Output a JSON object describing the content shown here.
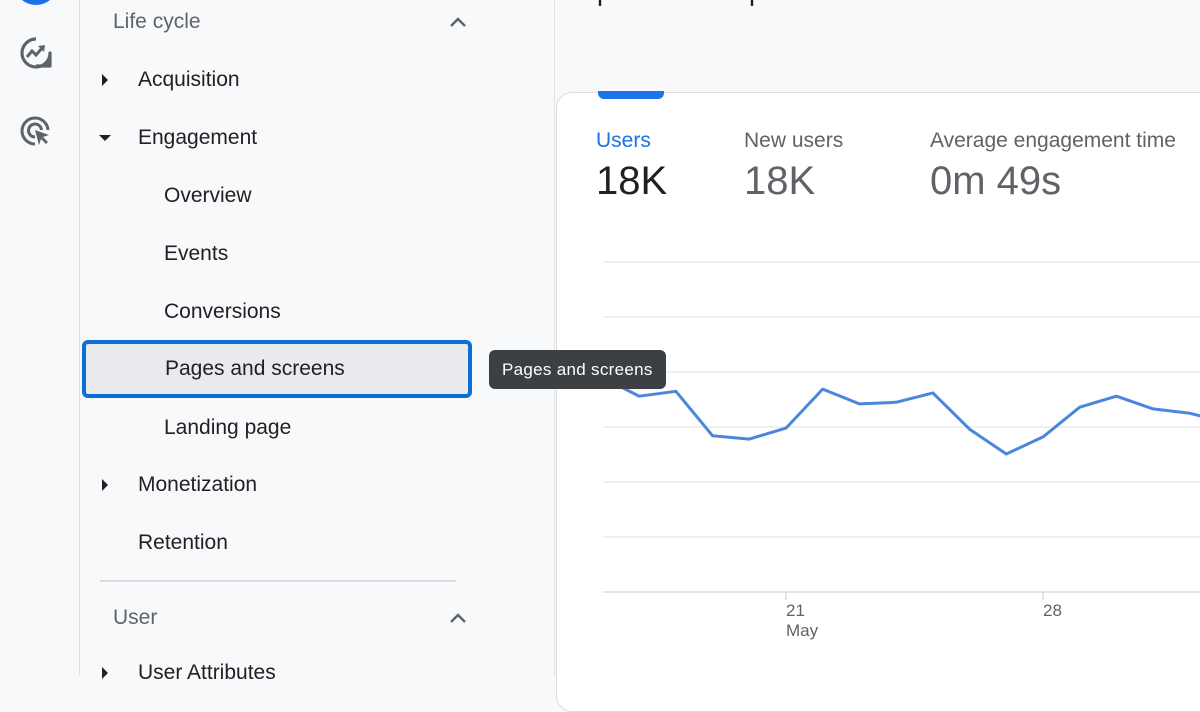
{
  "rail": {
    "icons": [
      "account-avatar",
      "reports-insights-icon",
      "advertising-target-icon"
    ]
  },
  "nav": {
    "sections": [
      {
        "label": "Life cycle",
        "expanded": true,
        "items": [
          {
            "label": "Acquisition",
            "level": 1,
            "arrow": "right"
          },
          {
            "label": "Engagement",
            "level": 1,
            "arrow": "down"
          },
          {
            "label": "Overview",
            "level": 2
          },
          {
            "label": "Events",
            "level": 2
          },
          {
            "label": "Conversions",
            "level": 2
          },
          {
            "label": "Pages and screens",
            "level": 2,
            "selected": true
          },
          {
            "label": "Landing page",
            "level": 2
          },
          {
            "label": "Monetization",
            "level": 1,
            "arrow": "right"
          },
          {
            "label": "Retention",
            "level": 1
          }
        ]
      },
      {
        "label": "User",
        "expanded": true,
        "items": [
          {
            "label": "User Attributes",
            "level": 1,
            "arrow": "right"
          }
        ]
      }
    ]
  },
  "tooltip": {
    "text": "Pages and screens"
  },
  "metrics": [
    {
      "label": "Users",
      "value": "18K",
      "active": true
    },
    {
      "label": "New users",
      "value": "18K",
      "active": false
    },
    {
      "label": "Average engagement time",
      "value": "0m 49s",
      "active": false
    }
  ],
  "colors": {
    "accent": "#1a73e8",
    "selection_outline": "#0b6fd6",
    "line": "#4a86dc",
    "tooltip_bg": "#3c4043"
  },
  "chart_data": {
    "type": "line",
    "title": "",
    "xlabel": "",
    "ylabel": "",
    "x_ticks": [
      {
        "day": 21,
        "label": "21",
        "sublabel": "May"
      },
      {
        "day": 28,
        "label": "28",
        "sublabel": ""
      }
    ],
    "x": [
      16,
      17,
      18,
      19,
      20,
      21,
      22,
      23,
      24,
      25,
      26,
      27,
      28,
      29,
      30,
      31,
      32,
      32.3
    ],
    "series": [
      {
        "name": "Users",
        "values": [
          3.9,
          3.56,
          3.65,
          2.84,
          2.78,
          2.98,
          3.69,
          3.42,
          3.45,
          3.62,
          2.96,
          2.51,
          2.82,
          3.36,
          3.56,
          3.33,
          3.25,
          3.2
        ]
      }
    ],
    "ylim": [
      0,
      6
    ],
    "gridlines": 7,
    "grid": true,
    "y_tick_labels_visible": false,
    "legend": "none"
  }
}
